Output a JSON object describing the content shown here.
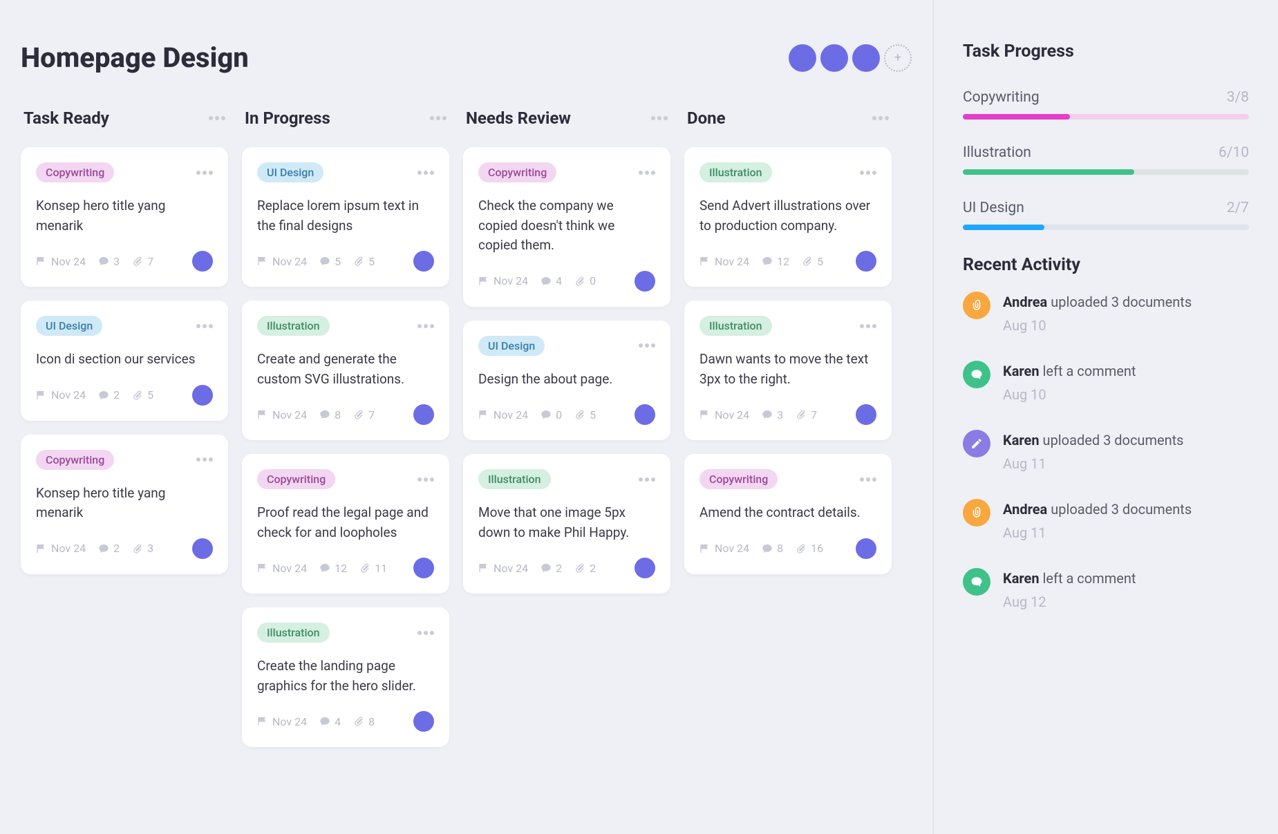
{
  "page_title": "Homepage Design",
  "avatars_visible": 3,
  "tag_styles": {
    "Copywriting": "copywriting",
    "UI Design": "uidesign",
    "Illustration": "illustration"
  },
  "columns": [
    {
      "title": "Task Ready",
      "cards": [
        {
          "tag": "Copywriting",
          "text": "Konsep hero title yang menarik",
          "date": "Nov 24",
          "comments": 3,
          "attachments": 7
        },
        {
          "tag": "UI Design",
          "text": "Icon di section our services",
          "date": "Nov 24",
          "comments": 2,
          "attachments": 5
        },
        {
          "tag": "Copywriting",
          "text": "Konsep hero title yang menarik",
          "date": "Nov 24",
          "comments": 2,
          "attachments": 3
        }
      ]
    },
    {
      "title": "In Progress",
      "cards": [
        {
          "tag": "UI Design",
          "text": "Replace lorem ipsum text in the final designs",
          "date": "Nov 24",
          "comments": 5,
          "attachments": 5
        },
        {
          "tag": "Illustration",
          "text": "Create and generate the custom SVG illustrations.",
          "date": "Nov 24",
          "comments": 8,
          "attachments": 7
        },
        {
          "tag": "Copywriting",
          "text": "Proof read the legal page and check for and loopholes",
          "date": "Nov 24",
          "comments": 12,
          "attachments": 11
        },
        {
          "tag": "Illustration",
          "text": "Create the landing page graphics for the hero slider.",
          "date": "Nov 24",
          "comments": 4,
          "attachments": 8
        }
      ]
    },
    {
      "title": "Needs Review",
      "cards": [
        {
          "tag": "Copywriting",
          "text": "Check the company we copied doesn't think we copied them.",
          "date": "Nov 24",
          "comments": 4,
          "attachments": 0
        },
        {
          "tag": "UI Design",
          "text": "Design the about page.",
          "date": "Nov 24",
          "comments": 0,
          "attachments": 5
        },
        {
          "tag": "Illustration",
          "text": "Move that one image 5px down to make Phil Happy.",
          "date": "Nov 24",
          "comments": 2,
          "attachments": 2
        }
      ]
    },
    {
      "title": "Done",
      "cards": [
        {
          "tag": "Illustration",
          "text": "Send Advert illustrations over to production company.",
          "date": "Nov 24",
          "comments": 12,
          "attachments": 5
        },
        {
          "tag": "Illustration",
          "text": "Dawn wants to move the text 3px to the right.",
          "date": "Nov 24",
          "comments": 3,
          "attachments": 7
        },
        {
          "tag": "Copywriting",
          "text": "Amend the contract details.",
          "date": "Nov 24",
          "comments": 8,
          "attachments": 16
        }
      ]
    }
  ],
  "sidebar": {
    "progress_title": "Task Progress",
    "progress": [
      {
        "label": "Copywriting",
        "done": 3,
        "total": 8,
        "color": "pink"
      },
      {
        "label": "Illustration",
        "done": 6,
        "total": 10,
        "color": "green"
      },
      {
        "label": "UI Design",
        "done": 2,
        "total": 7,
        "color": "blue"
      }
    ],
    "activity_title": "Recent Activity",
    "activity": [
      {
        "who": "Andrea",
        "what": "uploaded 3 documents",
        "when": "Aug 10",
        "icon": "attach",
        "color": "orange"
      },
      {
        "who": "Karen",
        "what": "left a comment",
        "when": "Aug 10",
        "icon": "comment",
        "color": "green"
      },
      {
        "who": "Karen",
        "what": "uploaded 3 documents",
        "when": "Aug 11",
        "icon": "edit",
        "color": "purple"
      },
      {
        "who": "Andrea",
        "what": "uploaded 3 documents",
        "when": "Aug 11",
        "icon": "attach",
        "color": "orange"
      },
      {
        "who": "Karen",
        "what": "left a comment",
        "when": "Aug 12",
        "icon": "comment",
        "color": "green"
      }
    ]
  }
}
